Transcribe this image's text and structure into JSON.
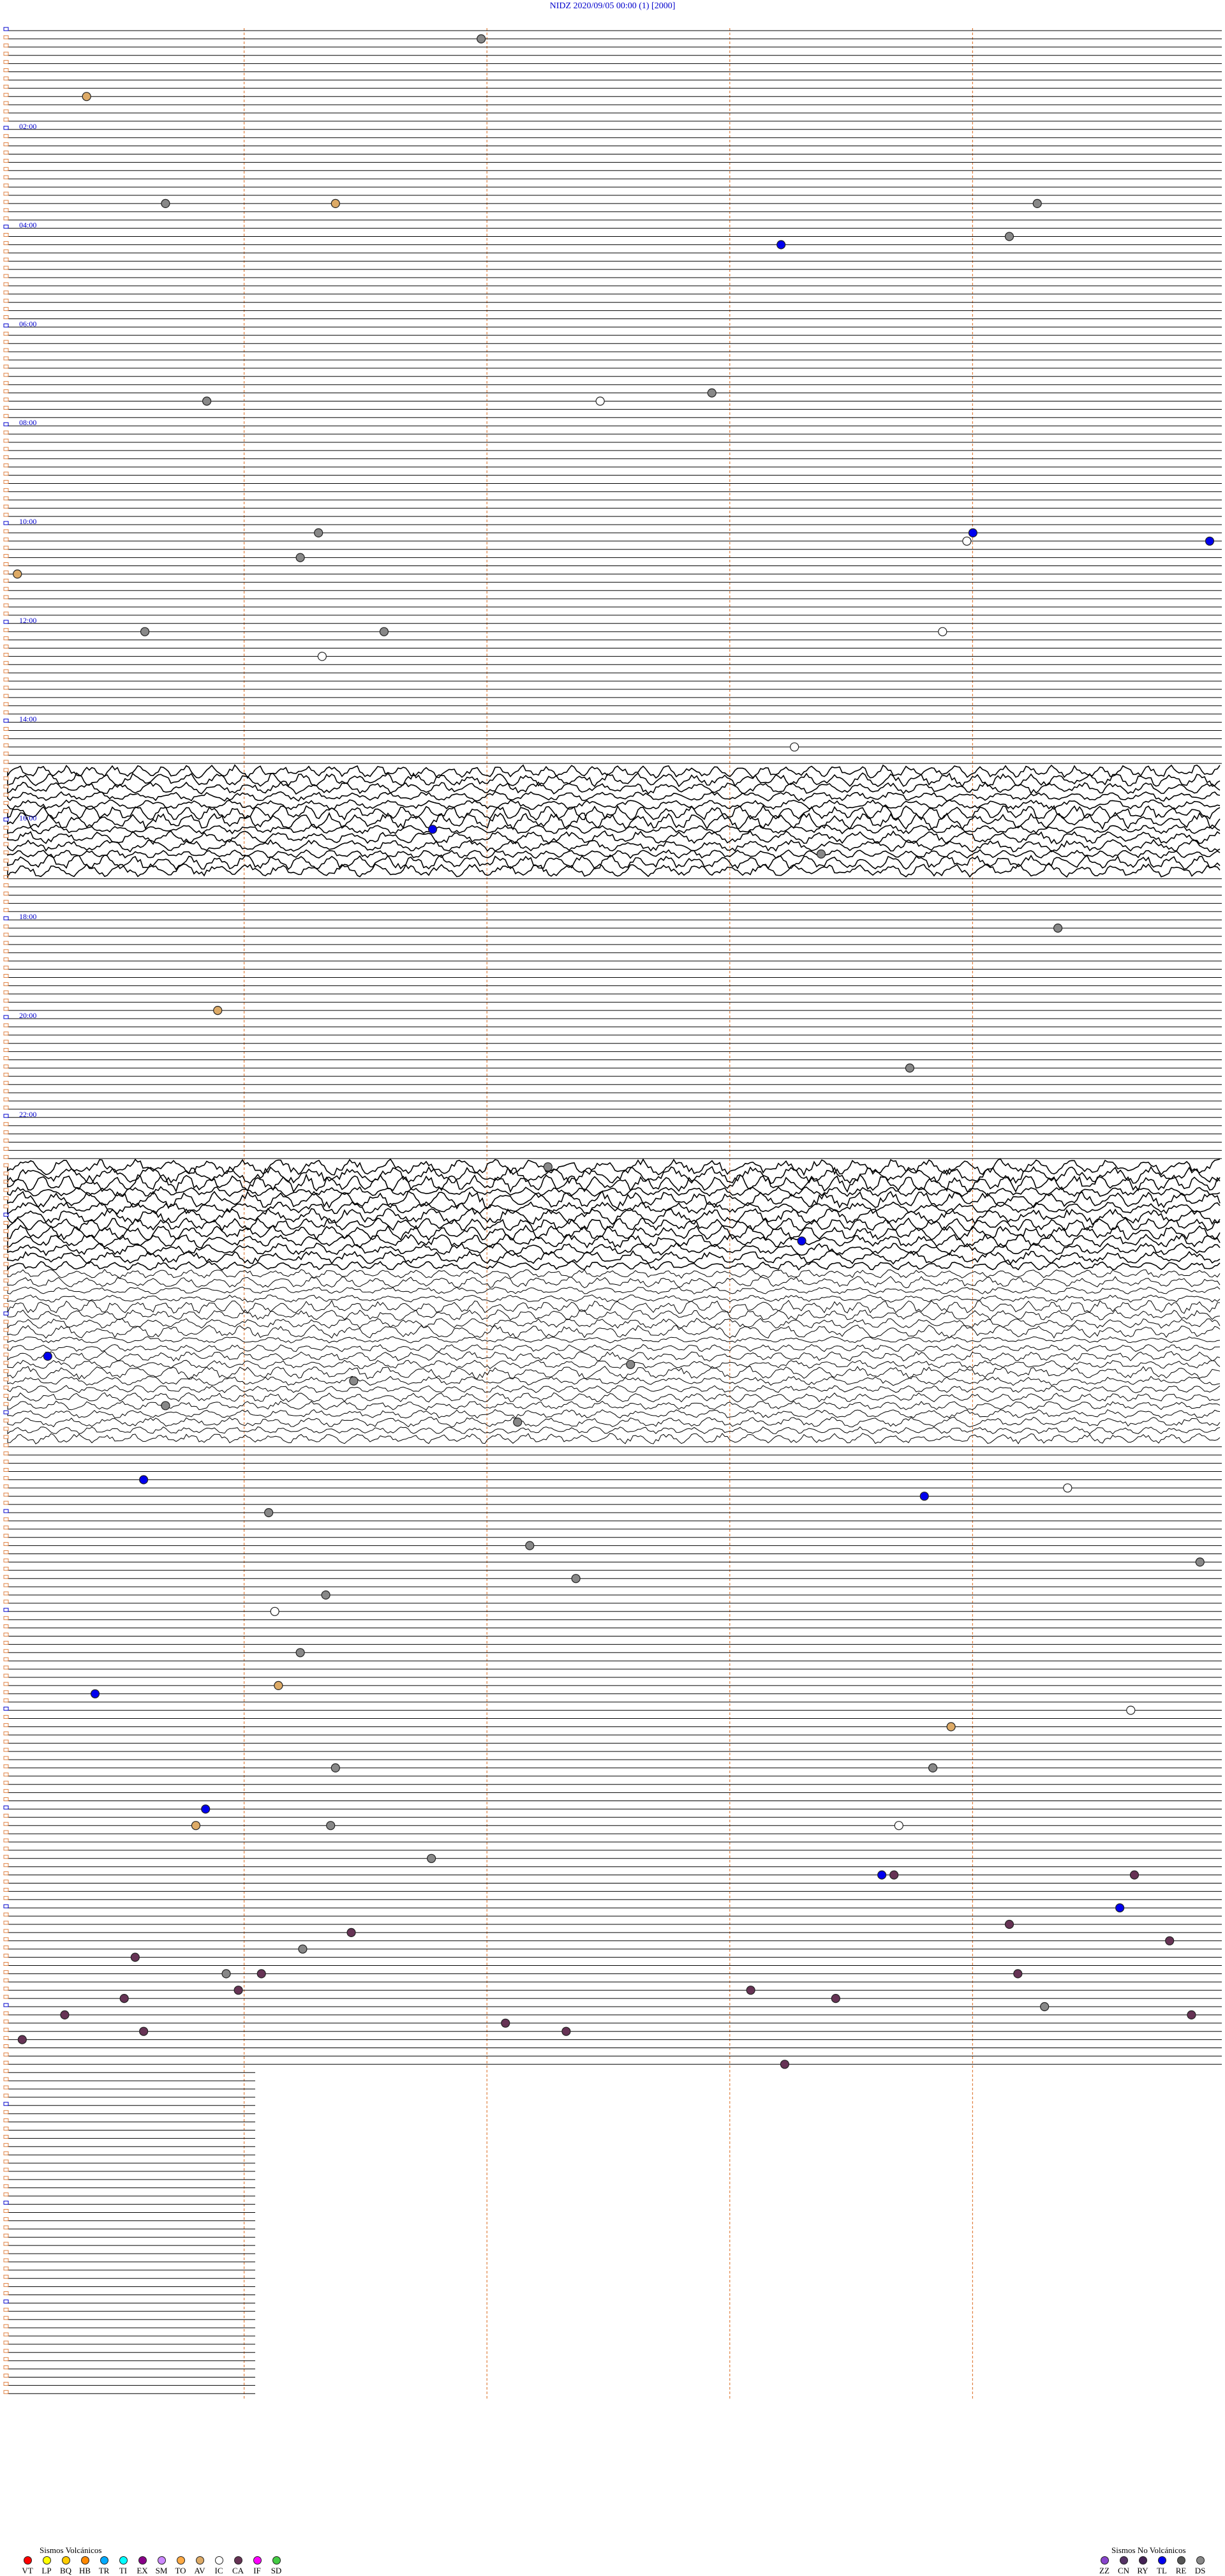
{
  "header": {
    "title": "NIDZ     2020/09/05 00:00      (1)    [2000]"
  },
  "chart_data": {
    "type": "scatter",
    "hour_labels": [
      "02:00",
      "04:00",
      "06:00",
      "08:00",
      "10:00",
      "12:00",
      "14:00",
      "16:00",
      "18:00",
      "20:00",
      "22:00"
    ],
    "lines_per_hour": 12,
    "total_lines": 288,
    "noisy_ranges": [
      [
        90,
        103
      ],
      [
        138,
        151
      ],
      [
        151,
        172
      ]
    ],
    "events": [
      {
        "row": 1,
        "x": 0.39,
        "type": "DS"
      },
      {
        "row": 8,
        "x": 0.065,
        "type": "AV"
      },
      {
        "row": 21,
        "x": 0.13,
        "type": "DS"
      },
      {
        "row": 21,
        "x": 0.27,
        "type": "AV"
      },
      {
        "row": 21,
        "x": 0.848,
        "type": "DS"
      },
      {
        "row": 25,
        "x": 0.825,
        "type": "DS"
      },
      {
        "row": 26,
        "x": 0.637,
        "type": "TL"
      },
      {
        "row": 44,
        "x": 0.58,
        "type": "DS"
      },
      {
        "row": 45,
        "x": 0.164,
        "type": "DS"
      },
      {
        "row": 45,
        "x": 0.488,
        "type": "IC"
      },
      {
        "row": 61,
        "x": 0.256,
        "type": "DS"
      },
      {
        "row": 61,
        "x": 0.795,
        "type": "TL"
      },
      {
        "row": 62,
        "x": 0.99,
        "type": "TL"
      },
      {
        "row": 62,
        "x": 0.79,
        "type": "IC"
      },
      {
        "row": 64,
        "x": 0.241,
        "type": "DS"
      },
      {
        "row": 66,
        "x": 0.008,
        "type": "AV"
      },
      {
        "row": 73,
        "x": 0.113,
        "type": "DS"
      },
      {
        "row": 73,
        "x": 0.31,
        "type": "DS"
      },
      {
        "row": 73,
        "x": 0.77,
        "type": "IC"
      },
      {
        "row": 76,
        "x": 0.259,
        "type": "IC"
      },
      {
        "row": 87,
        "x": 0.648,
        "type": "IC"
      },
      {
        "row": 97,
        "x": 0.35,
        "type": "TL"
      },
      {
        "row": 100,
        "x": 0.67,
        "type": "DS"
      },
      {
        "row": 109,
        "x": 0.865,
        "type": "DS"
      },
      {
        "row": 119,
        "x": 0.173,
        "type": "AV"
      },
      {
        "row": 126,
        "x": 0.743,
        "type": "DS"
      },
      {
        "row": 138,
        "x": 0.445,
        "type": "DS"
      },
      {
        "row": 147,
        "x": 0.654,
        "type": "TL"
      },
      {
        "row": 161,
        "x": 0.033,
        "type": "TL"
      },
      {
        "row": 162,
        "x": 0.513,
        "type": "DS"
      },
      {
        "row": 164,
        "x": 0.285,
        "type": "DS"
      },
      {
        "row": 167,
        "x": 0.13,
        "type": "DS"
      },
      {
        "row": 169,
        "x": 0.42,
        "type": "DS"
      },
      {
        "row": 176,
        "x": 0.112,
        "type": "TL"
      },
      {
        "row": 177,
        "x": 0.873,
        "type": "IC"
      },
      {
        "row": 178,
        "x": 0.755,
        "type": "TL"
      },
      {
        "row": 180,
        "x": 0.215,
        "type": "DS"
      },
      {
        "row": 184,
        "x": 0.43,
        "type": "DS"
      },
      {
        "row": 186,
        "x": 0.982,
        "type": "DS"
      },
      {
        "row": 188,
        "x": 0.468,
        "type": "DS"
      },
      {
        "row": 190,
        "x": 0.262,
        "type": "DS"
      },
      {
        "row": 192,
        "x": 0.22,
        "type": "IC"
      },
      {
        "row": 197,
        "x": 0.241,
        "type": "DS"
      },
      {
        "row": 201,
        "x": 0.223,
        "type": "AV"
      },
      {
        "row": 202,
        "x": 0.072,
        "type": "TL"
      },
      {
        "row": 204,
        "x": 0.925,
        "type": "IC"
      },
      {
        "row": 206,
        "x": 0.777,
        "type": "AV"
      },
      {
        "row": 211,
        "x": 0.27,
        "type": "DS"
      },
      {
        "row": 211,
        "x": 0.762,
        "type": "DS"
      },
      {
        "row": 216,
        "x": 0.163,
        "type": "TL"
      },
      {
        "row": 218,
        "x": 0.155,
        "type": "AV"
      },
      {
        "row": 218,
        "x": 0.266,
        "type": "DS"
      },
      {
        "row": 218,
        "x": 0.734,
        "type": "IC"
      },
      {
        "row": 222,
        "x": 0.349,
        "type": "DS"
      },
      {
        "row": 224,
        "x": 0.72,
        "type": "TL"
      },
      {
        "row": 224,
        "x": 0.73,
        "type": "CA"
      },
      {
        "row": 224,
        "x": 0.928,
        "type": "CA"
      },
      {
        "row": 228,
        "x": 0.916,
        "type": "TL"
      },
      {
        "row": 230,
        "x": 0.825,
        "type": "CA"
      },
      {
        "row": 231,
        "x": 0.283,
        "type": "CA"
      },
      {
        "row": 232,
        "x": 0.957,
        "type": "CA"
      },
      {
        "row": 233,
        "x": 0.243,
        "type": "DS"
      },
      {
        "row": 234,
        "x": 0.105,
        "type": "CA"
      },
      {
        "row": 236,
        "x": 0.209,
        "type": "CA"
      },
      {
        "row": 236,
        "x": 0.18,
        "type": "DS"
      },
      {
        "row": 236,
        "x": 0.832,
        "type": "CA"
      },
      {
        "row": 238,
        "x": 0.19,
        "type": "CA"
      },
      {
        "row": 238,
        "x": 0.612,
        "type": "CA"
      },
      {
        "row": 239,
        "x": 0.096,
        "type": "CA"
      },
      {
        "row": 239,
        "x": 0.682,
        "type": "CA"
      },
      {
        "row": 240,
        "x": 0.854,
        "type": "DS"
      },
      {
        "row": 241,
        "x": 0.047,
        "type": "CA"
      },
      {
        "row": 241,
        "x": 0.975,
        "type": "CA"
      },
      {
        "row": 242,
        "x": 0.41,
        "type": "CA"
      },
      {
        "row": 243,
        "x": 0.112,
        "type": "CA"
      },
      {
        "row": 243,
        "x": 0.46,
        "type": "CA"
      },
      {
        "row": 244,
        "x": 0.012,
        "type": "CA"
      },
      {
        "row": 247,
        "x": 0.64,
        "type": "CA"
      }
    ]
  },
  "legend": {
    "volcanic_title": "Sismos Volcánicos",
    "nonvolcanic_title": "Sismos No Volcánicos",
    "volcanic": [
      {
        "code": "VT",
        "color": "#ff0000"
      },
      {
        "code": "LP",
        "color": "#ffff00"
      },
      {
        "code": "BQ",
        "color": "#ffcc00"
      },
      {
        "code": "HB",
        "color": "#ff8800"
      },
      {
        "code": "TR",
        "color": "#00aaff"
      },
      {
        "code": "TI",
        "color": "#00ffff"
      },
      {
        "code": "EX",
        "color": "#880088"
      },
      {
        "code": "SM",
        "color": "#cc88ff"
      },
      {
        "code": "TO",
        "color": "#ffaa44"
      },
      {
        "code": "AV",
        "color": "#ddaa66"
      },
      {
        "code": "IC",
        "color": "#ffffff"
      },
      {
        "code": "CA",
        "color": "#663355"
      },
      {
        "code": "IF",
        "color": "#ff00ff"
      },
      {
        "code": "SD",
        "color": "#44cc44"
      }
    ],
    "nonvolcanic": [
      {
        "code": "ZZ",
        "color": "#8844cc"
      },
      {
        "code": "CN",
        "color": "#553366"
      },
      {
        "code": "RY",
        "color": "#442255"
      },
      {
        "code": "TL",
        "color": "#0000ee"
      },
      {
        "code": "RE",
        "color": "#555555"
      },
      {
        "code": "DS",
        "color": "#888888"
      }
    ]
  }
}
